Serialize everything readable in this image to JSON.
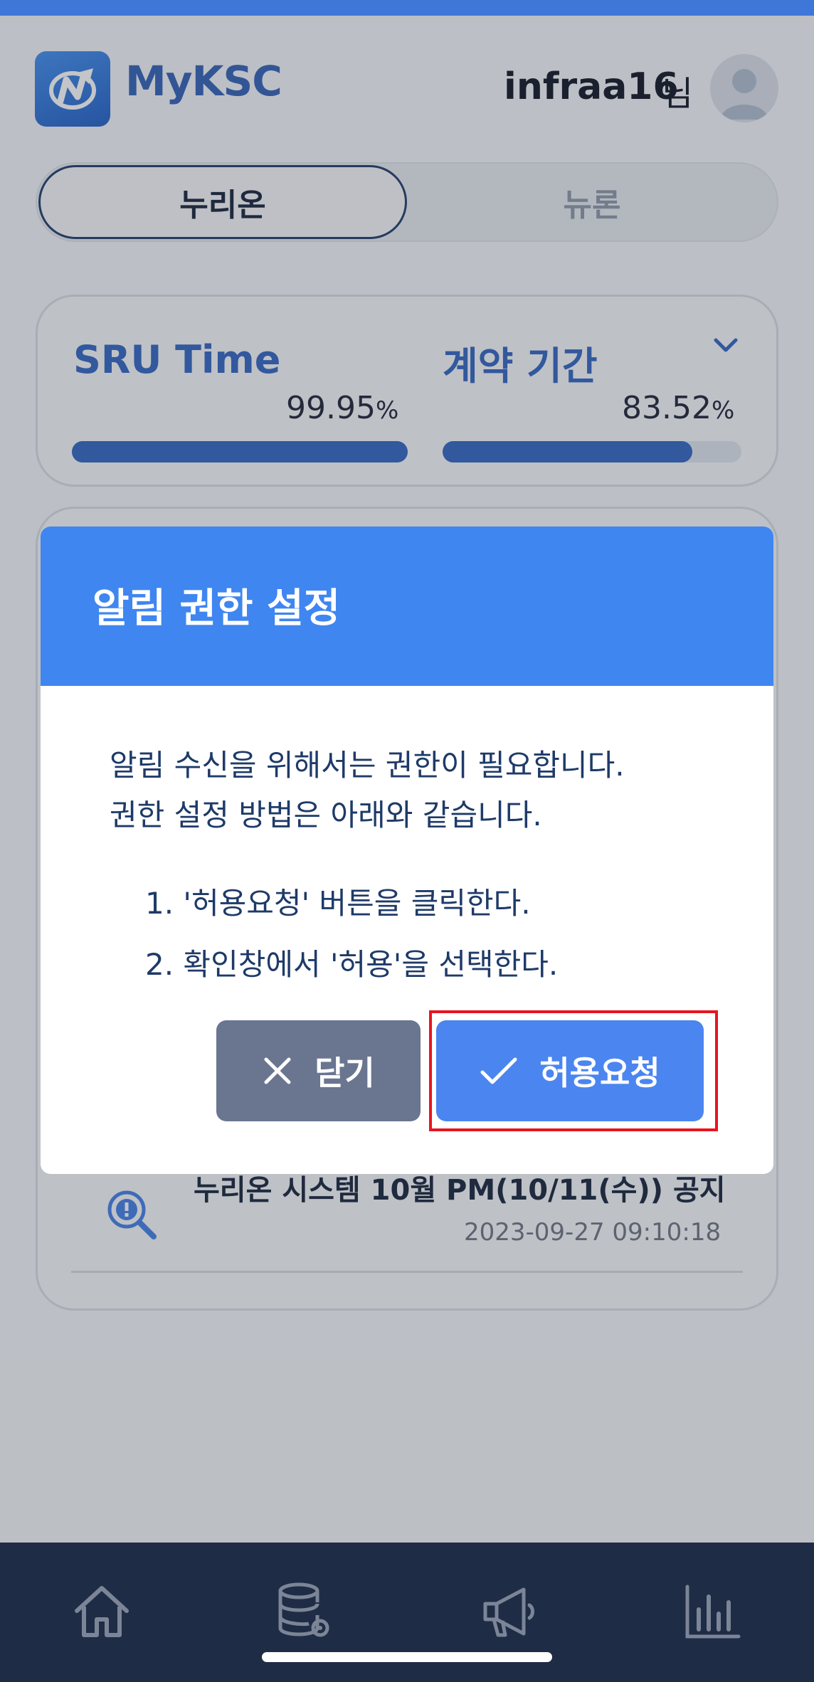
{
  "header": {
    "app_name": "MyKSC",
    "user_name": "infraa16",
    "user_suffix": "님"
  },
  "tabs": [
    {
      "label": "누리온",
      "active": true
    },
    {
      "label": "뉴론",
      "active": false
    }
  ],
  "usage": {
    "sru": {
      "label": "SRU Time",
      "value": "99.95",
      "unit": "%",
      "progress_percent": 99.95
    },
    "contract": {
      "label": "계약 기간",
      "value": "83.52",
      "unit": "%",
      "progress_percent": 83.52
    }
  },
  "notice": {
    "title": "누리온 시스템 10월 PM(10/11(수)) 공지",
    "date": "2023-09-27 09:10:18"
  },
  "dialog": {
    "title": "알림 권한 설정",
    "line1": "알림 수신을 위해서는 권한이 필요합니다.",
    "line2": "권한 설정 방법은 아래와 같습니다.",
    "step1": "1. '허용요청' 버튼을 클릭한다.",
    "step2": "2. 확인창에서 '허용'을 선택한다.",
    "close_label": "닫기",
    "allow_label": "허용요청"
  },
  "colors": {
    "accent": "#3f86f0",
    "highlight": "#e8141f",
    "nav_background": "#1e2c45"
  },
  "nav": {
    "icons": [
      "home-icon",
      "database-settings-icon",
      "megaphone-icon",
      "bar-chart-icon"
    ]
  }
}
